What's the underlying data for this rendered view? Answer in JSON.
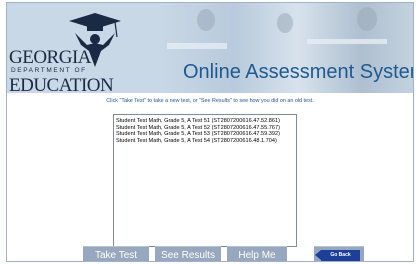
{
  "logo": {
    "line1": "GEORGIA",
    "line2": "DEPARTMENT OF",
    "line3": "EDUCATION"
  },
  "header": {
    "title": "Online Assessment System"
  },
  "instructions": "Click \"Take Test\" to take a new test, or \"See Results\" to see how you did on an old test.",
  "tests": [
    "Student Test Math, Grade 5, A Test 51 (ST2807200616.47.52.861)",
    "Student Test Math, Grade 5, A Test 52 (ST2807200616.47.55.767)",
    "Student Test Math, Grade 5, A Test 53 (ST2807200616.47.59.392)",
    "Student Test Math, Grade 5, A Test 54 (ST2807200616.48.1.704)"
  ],
  "buttons": {
    "take_test": "Take Test",
    "see_results": "See Results",
    "help_me": "Help Me",
    "go_back": "Go Back"
  },
  "colors": {
    "header_bg": "#c9d8e6",
    "title": "#1e5a91",
    "button": "#97a7bd",
    "go_back": "#1c3f9a"
  }
}
